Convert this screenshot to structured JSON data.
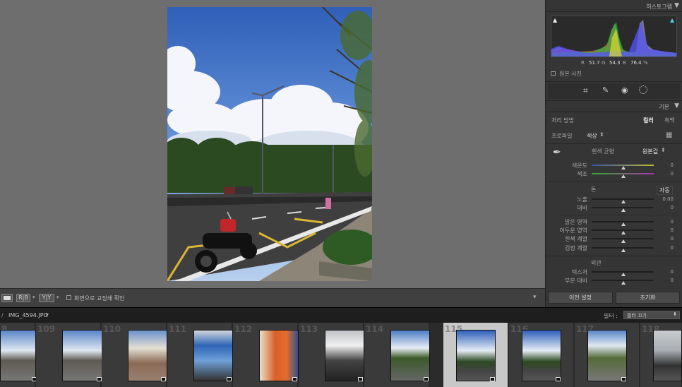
{
  "toolbar": {
    "view_btn_1": "",
    "view_btn_2": "R|B",
    "view_btn_3": "Y|Y",
    "softproof_label": "화면으로 교정쇄 확인"
  },
  "panel": {
    "histogram_title": "히스토그램",
    "rgb": {
      "r_label": "R",
      "r_value": "51.7",
      "g_label": "G",
      "g_value": "54.3",
      "b_label": "B",
      "b_value": "76.4",
      "unit": "%"
    },
    "original_photo_label": "원본 사진",
    "basic_title": "기본",
    "treatment_label": "처리 방법",
    "treatment_color": "컬러",
    "treatment_bw": "흑백",
    "profile_label": "프로파일",
    "profile_value": "색상",
    "wb_label": "흰색 균형",
    "wb_value": "원본값",
    "temp_label": "색온도",
    "temp_value": "0",
    "tint_label": "색조",
    "tint_value": "0",
    "tone_label": "톤",
    "auto_label": "자동",
    "exposure_label": "노출",
    "exposure_value": "0.00",
    "contrast_label": "대비",
    "contrast_value": "0",
    "highlights_label": "밝은 영역",
    "highlights_value": "0",
    "shadows_label": "어두운 영역",
    "shadows_value": "0",
    "whites_label": "흰색 계열",
    "whites_value": "0",
    "blacks_label": "검정 계열",
    "blacks_value": "0",
    "presence_label": "외관",
    "texture_label": "텍스처",
    "texture_value": "0",
    "clarity_label": "부분 대비",
    "clarity_value": "0",
    "previous_btn": "이전 설정",
    "reset_btn": "초기화"
  },
  "filmbar": {
    "path_prefix": "/",
    "filename": "IMG_4594.JPG",
    "filter_label": "필터 :",
    "filter_value": "필터 끄기"
  },
  "filmstrip": {
    "numbers": [
      "8",
      "109",
      "110",
      "111",
      "112",
      "113",
      "114",
      "115",
      "116",
      "117",
      "118"
    ],
    "selected_index": 7
  },
  "colors": {
    "panel_bg": "#353535",
    "viewer_bg": "#6e6e6e",
    "filmstrip_bg": "#2b2b2b",
    "selected_cell": "#c8c8c8"
  }
}
